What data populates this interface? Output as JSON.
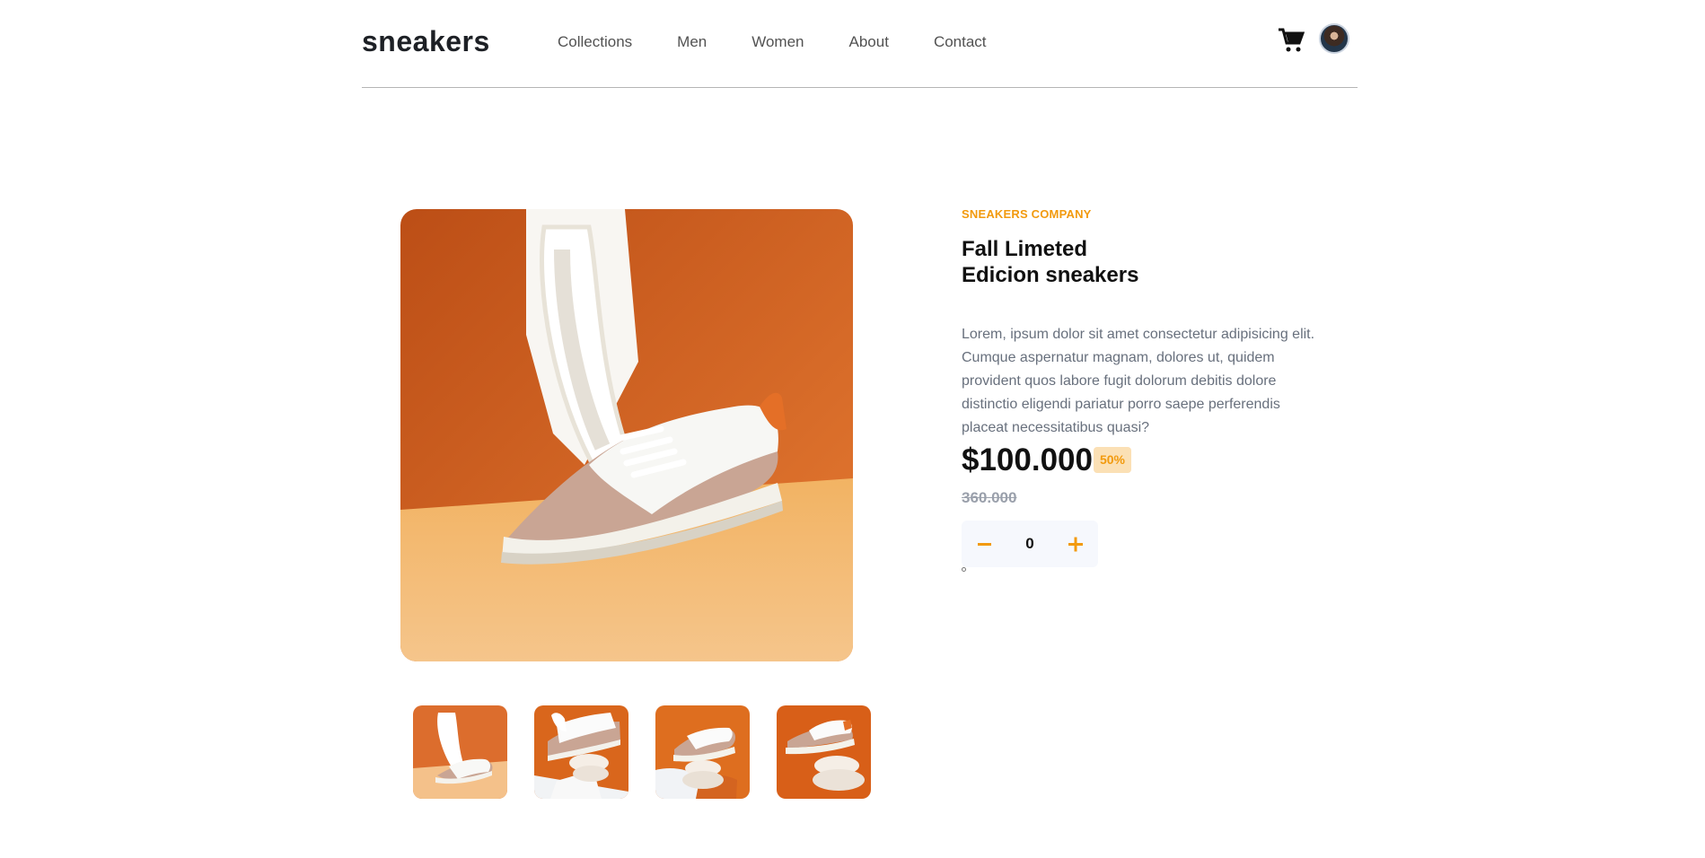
{
  "header": {
    "logo": "sneakers",
    "nav": [
      "Collections",
      "Men",
      "Women",
      "About",
      "Contact"
    ],
    "icons": [
      "cart-icon",
      "avatar"
    ]
  },
  "product": {
    "company": "SNEAKERS COMPANY",
    "title_line1": "Fall Limeted",
    "title_line2": "Edicion sneakers",
    "description": "Lorem, ipsum dolor sit amet consectetur adipisicing elit. Cumque aspernatur magnam, dolores ut, quidem provident quos labore fugit dolorum debitis dolore distinctio eligendi pariatur porro saepe perferendis placeat necessitatibus quasi?",
    "price": "$100.000",
    "discount": "50%",
    "old_price": "360.000",
    "quantity": "0"
  },
  "images": {
    "main": "sneaker-main",
    "thumbnails": [
      "sneaker-thumb-1",
      "sneaker-thumb-2",
      "sneaker-thumb-3",
      "sneaker-thumb-4"
    ]
  },
  "colors": {
    "accent": "#f29a0e",
    "accent_light": "#fbe0b5",
    "text_dark": "#111111",
    "text_muted": "#68707d"
  }
}
